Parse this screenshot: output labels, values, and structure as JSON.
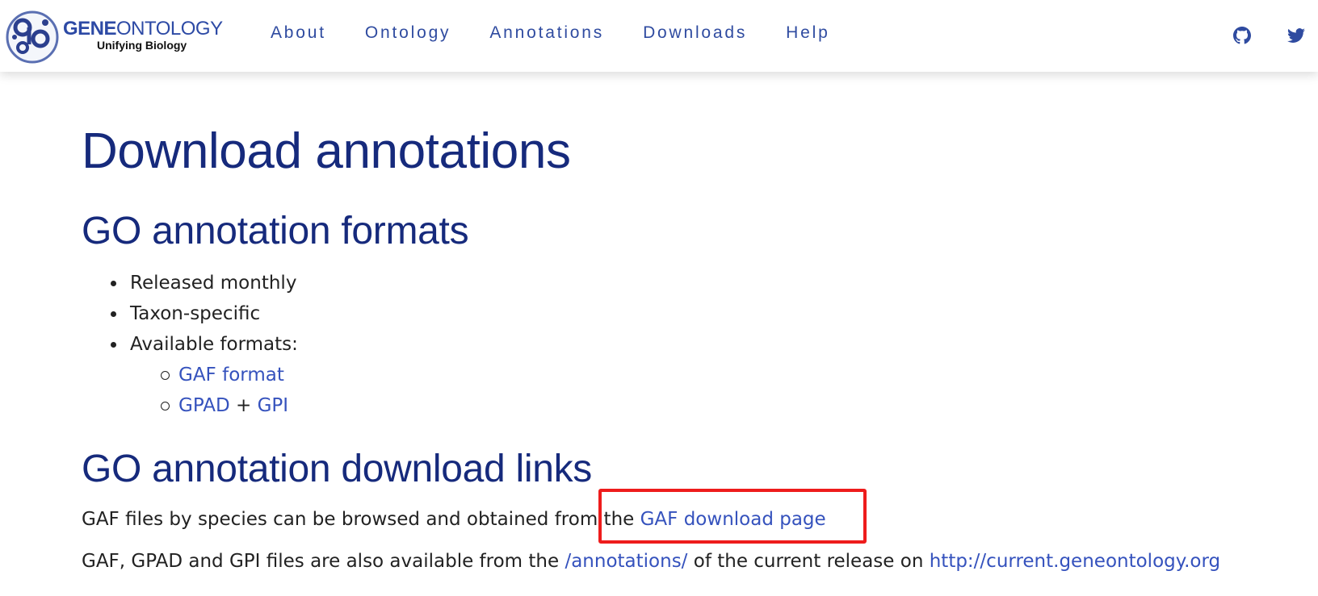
{
  "header": {
    "logo_title_gene": "GENE",
    "logo_title_ontology": "ONTOLOGY",
    "logo_subtitle": "Unifying Biology",
    "nav": [
      {
        "label": "About"
      },
      {
        "label": "Ontology"
      },
      {
        "label": "Annotations"
      },
      {
        "label": "Downloads"
      },
      {
        "label": "Help"
      }
    ],
    "social_icons": [
      "github-icon",
      "twitter-icon"
    ]
  },
  "main": {
    "page_title": "Download annotations",
    "formats_section": {
      "title": "GO annotation formats",
      "items": [
        "Released monthly",
        "Taxon-specific",
        "Available formats:"
      ],
      "sub_items": {
        "gaf": "GAF format",
        "gpad": "GPAD",
        "plus": "+",
        "gpi": "GPI"
      }
    },
    "links_section": {
      "title": "GO annotation download links",
      "para1_text": "GAF files by species can be browsed and obtained from the ",
      "para1_link": "GAF download page",
      "para2_prefix": "GAF, GPAD and GPI files are also available from the ",
      "para2_link1": "/annotations/",
      "para2_middle": " of the current release on ",
      "para2_link2": "http://current.geneontology.org"
    }
  },
  "colors": {
    "heading": "#162a7c",
    "nav": "#2f4ba0",
    "link": "#3552bd",
    "highlight": "#ee1c1c"
  }
}
